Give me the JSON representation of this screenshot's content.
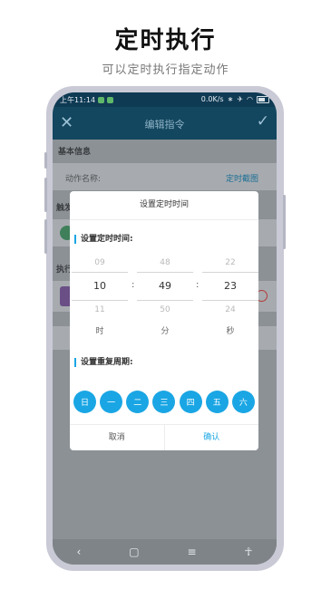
{
  "promo": {
    "title": "定时执行",
    "subtitle": "可以定时执行指定动作"
  },
  "statusbar": {
    "time": "上午11:14",
    "network_speed": "0.0K/s",
    "icons": [
      "bluetooth-icon",
      "airplane-icon",
      "wifi-icon",
      "battery-icon"
    ]
  },
  "toolbar": {
    "title": "编辑指令",
    "close_icon": "close-icon",
    "confirm_icon": "check-icon"
  },
  "background": {
    "basic_info_label": "基本信息",
    "action_name_label": "动作名称:",
    "action_name_value": "定时截图",
    "trigger_label": "触发",
    "execute_label": "执行"
  },
  "dialog": {
    "title": "设置定时时间",
    "time_section_label": "设置定时时间:",
    "hours": {
      "prev": "09",
      "current": "10",
      "next": "11",
      "unit": "时"
    },
    "minutes": {
      "prev": "48",
      "current": "49",
      "next": "50",
      "unit": "分"
    },
    "seconds": {
      "prev": "22",
      "current": "23",
      "next": "24",
      "unit": "秒"
    },
    "separator": ":",
    "repeat_section_label": "设置重复周期:",
    "days": [
      "日",
      "一",
      "二",
      "三",
      "四",
      "五",
      "六"
    ],
    "cancel_label": "取消",
    "confirm_label": "确认"
  },
  "navbar": {
    "back": "‹",
    "home": "▢",
    "menu": "≡"
  },
  "colors": {
    "accent": "#1aa6e4",
    "toolbar": "#13475f",
    "statusbar": "#0f3a54",
    "phone_frame": "#c9cad6"
  }
}
